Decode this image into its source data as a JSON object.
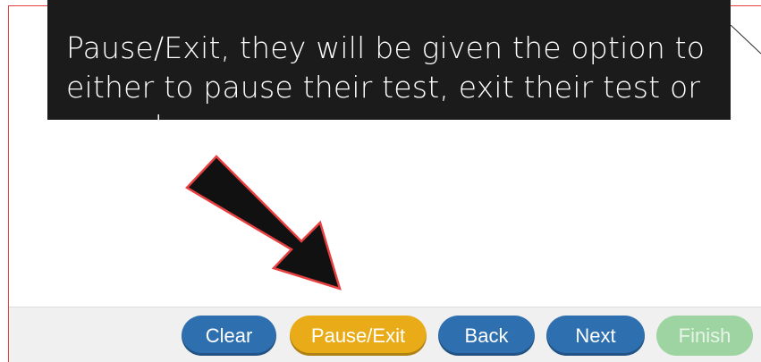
{
  "callout": {
    "text": "Pause/Exit, they will be given the option to\neither to pause their test, exit their test or\ncancel."
  },
  "toolbar": {
    "clear_label": "Clear",
    "pause_exit_label": "Pause/Exit",
    "back_label": "Back",
    "next_label": "Next",
    "finish_label": "Finish",
    "finish_state": "disabled"
  },
  "colors": {
    "primary_button": "#2e6fb0",
    "pause_button": "#e9ac18",
    "finish_disabled": "#9ed4a2",
    "callout_background": "#1b1b1b",
    "frame_border": "#e84040",
    "arrow_outline": "#e84040"
  },
  "icons": {
    "annotation_arrow": "arrow-down-right-icon"
  }
}
